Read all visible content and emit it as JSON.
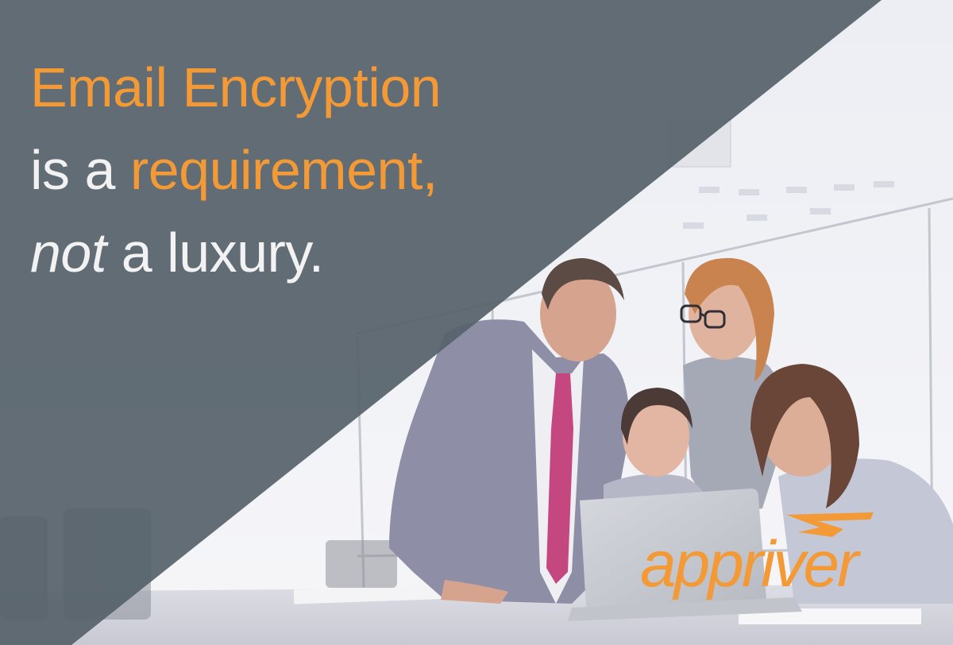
{
  "headline": {
    "line1": {
      "part1": "Email Encryption"
    },
    "line2": {
      "part1": "is a",
      "part2": "requirement,"
    },
    "line3": {
      "part1": "not",
      "part2": "a luxury."
    }
  },
  "logo": {
    "text": "appriver"
  },
  "colors": {
    "accent": "#f39a36",
    "overlay": "#56626b",
    "text_light": "#f2f2f2",
    "background": "#f2f3f7"
  }
}
